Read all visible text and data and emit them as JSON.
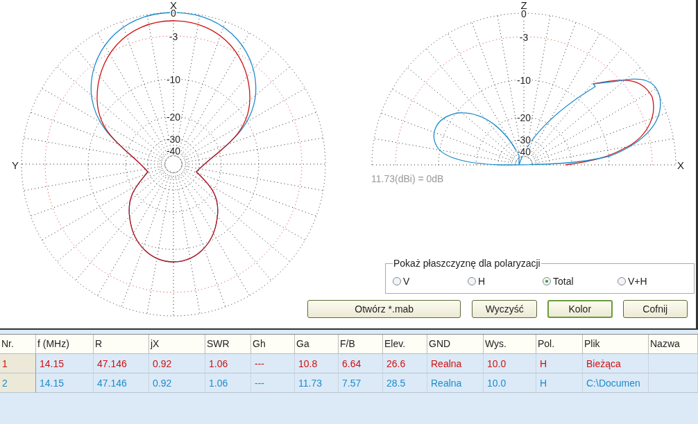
{
  "azimuth_plot": {
    "axis_top": "X",
    "axis_left": "Y",
    "ring_labels": [
      "0",
      "-3",
      "-10",
      "-20",
      "-30",
      "-40"
    ]
  },
  "elevation_plot": {
    "axis_top": "Z",
    "axis_right": "X",
    "ring_labels": [
      "0",
      "-3",
      "-10",
      "-20",
      "-30",
      "-40"
    ],
    "gain_note": "11.73(dBi) = 0dB"
  },
  "polarization": {
    "title": "Pokaż płaszczyznę dla polaryzacji",
    "options": [
      {
        "label": "V",
        "selected": false
      },
      {
        "label": "H",
        "selected": false
      },
      {
        "label": "Total",
        "selected": true
      },
      {
        "label": "V+H",
        "selected": false
      }
    ]
  },
  "buttons": [
    {
      "label": "Otwórz *.mab",
      "default": false
    },
    {
      "label": "Wyczyść",
      "default": false
    },
    {
      "label": "Kolor",
      "default": true
    },
    {
      "label": "Cofnij",
      "default": false
    }
  ],
  "table": {
    "columns": [
      "Nr.",
      "f (MHz)",
      "R",
      "jX",
      "SWR",
      "Gh",
      "Ga",
      "F/B",
      "Elev.",
      "GND",
      "Wys.",
      "Pol.",
      "Plik",
      "Nazwa"
    ],
    "rows": [
      {
        "color": "#d01010",
        "cells": [
          "1",
          "14.15",
          "47.146",
          "0.92",
          "1.06",
          "---",
          "10.8",
          "6.64",
          "26.6",
          "Realna",
          "10.0",
          "H",
          "Bieżąca",
          ""
        ]
      },
      {
        "color": "#1a8ccc",
        "cells": [
          "2",
          "14.15",
          "47.146",
          "0.92",
          "1.06",
          "---",
          "11.73",
          "7.57",
          "28.5",
          "Realna",
          "10.0",
          "H",
          "C:\\Documen",
          ""
        ]
      }
    ]
  }
}
